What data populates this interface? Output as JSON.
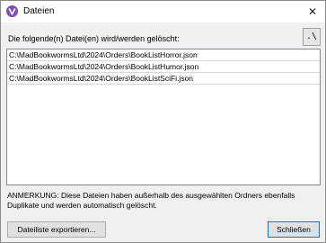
{
  "window": {
    "title": "Dateien",
    "app_icon": "app-logo-icon",
    "close_glyph": "✕"
  },
  "dialog": {
    "prompt": "Die folgende(n) Datei(en) wird/werden gelöscht:",
    "open_folder_label": ".\\",
    "files": [
      "C:\\MadBookwormsLtd\\2024\\Orders\\BookListHorror.json",
      "C:\\MadBookwormsLtd\\2024\\Orders\\BookListHumor.json",
      "C:\\MadBookwormsLtd\\2024\\Orders\\BookListSciFi.json"
    ],
    "note": "ANMERKUNG: Diese Dateien haben außerhalb des ausgewählten Ordners ebenfalls Duplikate und werden automatisch gelöscht."
  },
  "buttons": {
    "export_label": "Dateiliste exportieren...",
    "close_label": "Schließen"
  },
  "colors": {
    "app_icon": "#7a4fb8",
    "default_button_border": "#0078d7"
  }
}
